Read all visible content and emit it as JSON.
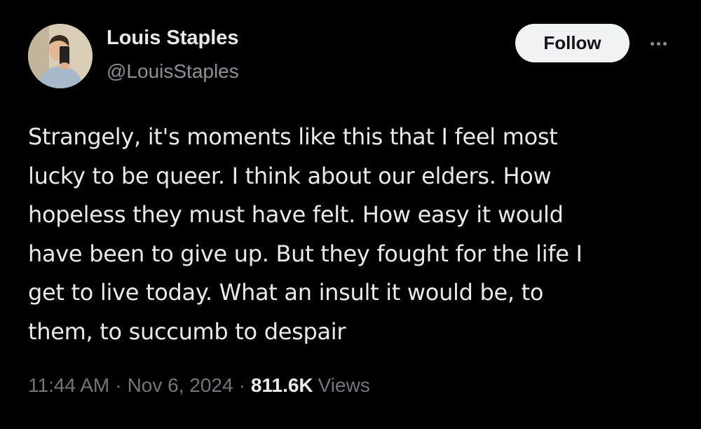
{
  "author": {
    "display_name": "Louis Staples",
    "handle": "@LouisStaples"
  },
  "actions": {
    "follow_label": "Follow",
    "more_icon": "more-horizontal-icon"
  },
  "tweet": {
    "lines": [
      "Strangely, it's moments like this that I feel most",
      "lucky to be queer. I think about our elders. How",
      "hopeless they must have felt. How easy it would",
      "have been to give up. But they fought for the life I",
      "get to live today. What an insult it would be, to",
      "them, to succumb to despair"
    ]
  },
  "meta": {
    "time": "11:44 AM",
    "separator": "·",
    "date": "Nov 6, 2024",
    "views_count": "811.6K",
    "views_label": "Views"
  },
  "colors": {
    "background": "#000000",
    "primary_text": "#e7e9ea",
    "secondary_text": "#71767b",
    "follow_button_bg": "#eff3f4"
  }
}
